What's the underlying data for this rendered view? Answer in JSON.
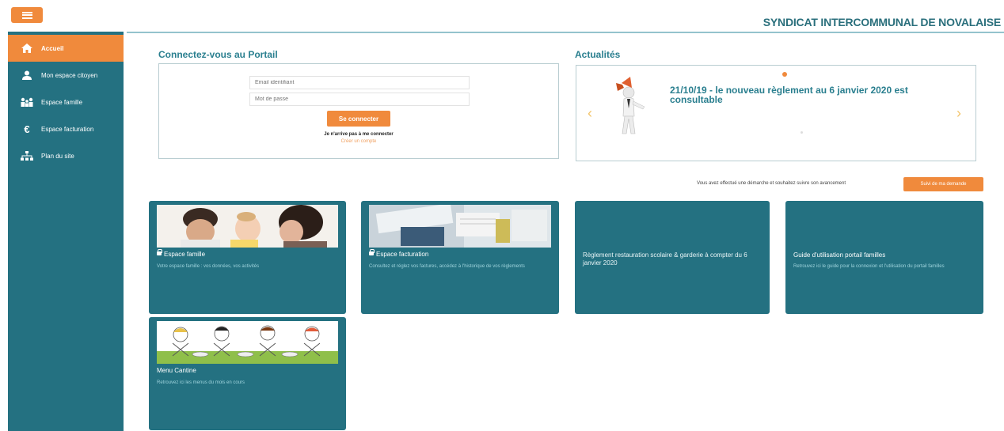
{
  "header": {
    "site_title": "SYNDICAT INTERCOMMUNAL DE NOVALAISE",
    "menu_icon": "hamburger-icon"
  },
  "sidebar": {
    "items": [
      {
        "label": "Accueil",
        "icon": "home-icon",
        "active": true
      },
      {
        "label": "Mon espace citoyen",
        "icon": "user-icon",
        "active": false
      },
      {
        "label": "Espace famille",
        "icon": "family-icon",
        "active": false
      },
      {
        "label": "Espace facturation",
        "icon": "euro-icon",
        "active": false
      },
      {
        "label": "Plan du site",
        "icon": "sitemap-icon",
        "active": false
      }
    ]
  },
  "login": {
    "section_title": "Connectez-vous au Portail",
    "email_placeholder": "Email identifiant",
    "password_placeholder": "Mot de passe",
    "submit_label": "Se connecter",
    "cant_connect": "Je n'arrive pas à me connecter",
    "create_account": "Créer un compte"
  },
  "news": {
    "section_title": "Actualités",
    "headline": "21/10/19 - le nouveau règlement au 6 janvier 2020 est consultable",
    "prev_icon": "chevron-left-icon",
    "next_icon": "chevron-right-icon"
  },
  "tracking": {
    "text": "Vous avez effectué une démarche et souhaitez suivre son avancement",
    "button_label": "Suivi de ma demande"
  },
  "tiles": [
    {
      "title": "Espace famille",
      "locked": true,
      "description": "Votre espace famille : vos données, vos activités"
    },
    {
      "title": "Espace facturation",
      "locked": true,
      "description": "Consultez et réglez vos factures, accédez à l'historique de vos règlements"
    },
    {
      "title": "Règlement restauration scolaire & garderie à compter du 6 janvier 2020"
    },
    {
      "title": "Guide d'utilisation portail familles",
      "description": "Retrouvez ici le guide pour la connexion et l'utilisation du portail familles"
    },
    {
      "title": "Menu Cantine",
      "description": "Retrouvez ici les menus du mois en cours"
    }
  ],
  "colors": {
    "accent": "#f08a3c",
    "primary": "#247181",
    "title_text": "#2a7f8f"
  }
}
